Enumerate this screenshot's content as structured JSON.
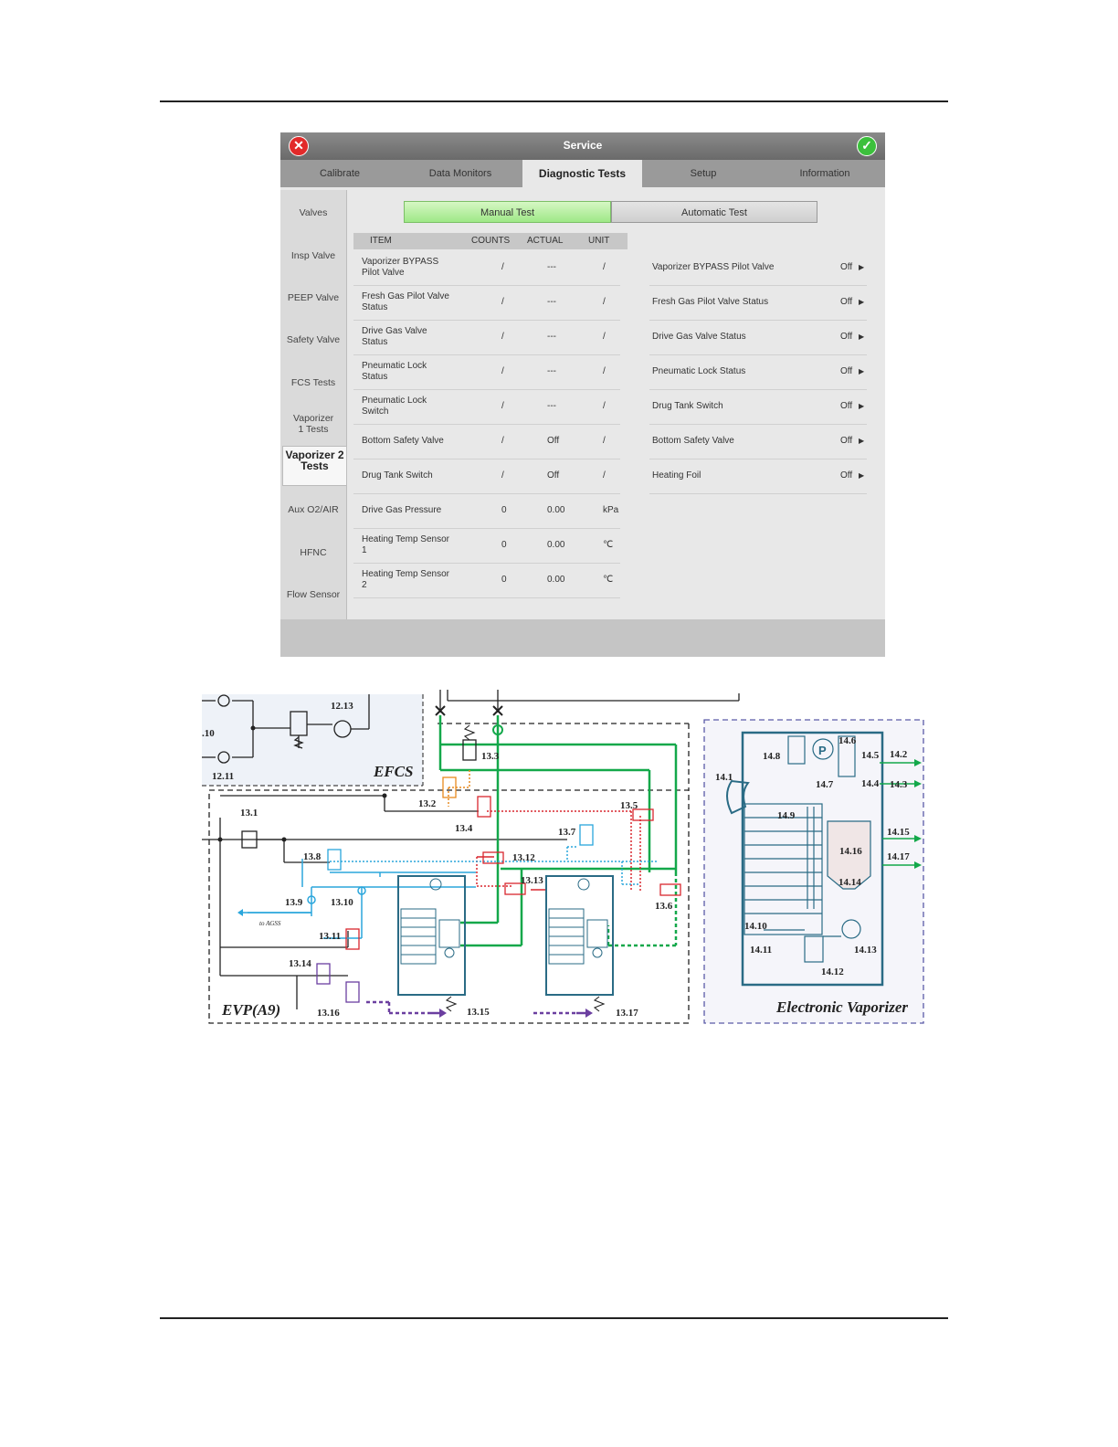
{
  "window": {
    "title": "Service"
  },
  "tabs": [
    "Calibrate",
    "Data Monitors",
    "Diagnostic Tests",
    "Setup",
    "Information"
  ],
  "sidebar": [
    "Valves",
    "Insp Valve",
    "PEEP Valve",
    "Safety Valve",
    "FCS Tests",
    "Vaporizer 1 Tests",
    "Vaporizer 2 Tests",
    "Aux O2/AIR",
    "HFNC",
    "Flow Sensor"
  ],
  "mode": {
    "manual": "Manual Test",
    "automatic": "Automatic Test"
  },
  "table": {
    "headers": {
      "item": "ITEM",
      "counts": "COUNTS",
      "actual": "ACTUAL",
      "unit": "UNIT"
    },
    "rows": [
      {
        "item": "Vaporizer BYPASS Pilot Valve",
        "counts": "/",
        "actual": "---",
        "unit": "/"
      },
      {
        "item": "Fresh Gas Pilot Valve Status",
        "counts": "/",
        "actual": "---",
        "unit": "/"
      },
      {
        "item": "Drive Gas Valve Status",
        "counts": "/",
        "actual": "---",
        "unit": "/"
      },
      {
        "item": "Pneumatic Lock Status",
        "counts": "/",
        "actual": "---",
        "unit": "/"
      },
      {
        "item": "Pneumatic Lock Switch",
        "counts": "/",
        "actual": "---",
        "unit": "/"
      },
      {
        "item": "Bottom Safety Valve",
        "counts": "/",
        "actual": "Off",
        "unit": "/"
      },
      {
        "item": "Drug Tank Switch",
        "counts": "/",
        "actual": "Off",
        "unit": "/"
      },
      {
        "item": "Drive Gas Pressure",
        "counts": "0",
        "actual": "0.00",
        "unit": "kPa"
      },
      {
        "item": "Heating Temp Sensor 1",
        "counts": "0",
        "actual": "0.00",
        "unit": "℃"
      },
      {
        "item": "Heating Temp Sensor 2",
        "counts": "0",
        "actual": "0.00",
        "unit": "℃"
      }
    ]
  },
  "controls": [
    {
      "label": "Vaporizer BYPASS Pilot Valve",
      "value": "Off"
    },
    {
      "label": "Fresh Gas Pilot Valve Status",
      "value": "Off"
    },
    {
      "label": "Drive Gas Valve Status",
      "value": "Off"
    },
    {
      "label": "Pneumatic Lock Status",
      "value": "Off"
    },
    {
      "label": "Drug Tank Switch",
      "value": "Off"
    },
    {
      "label": "Bottom Safety Valve",
      "value": "Off"
    },
    {
      "label": "Heating Foil",
      "value": "Off"
    }
  ],
  "schematic": {
    "sections": {
      "efcs": "EFCS",
      "evp": "EVP(A9)",
      "vaporizer": "Electronic Vaporizer"
    },
    "small_text": "to AGSS",
    "labels": {
      "l1213": "12.13",
      "l10": ".10",
      "l1211": "12.11",
      "l133": "13.3",
      "l132": "13.2",
      "l134": "13.4",
      "l131": "13.1",
      "l135": "13.5",
      "l137": "13.7",
      "l138": "13.8",
      "l1312": "13.12",
      "l1313": "13.13",
      "l139": "13.9",
      "l1310": "13.10",
      "l1311": "13.11",
      "l1314": "13.14",
      "l1316": "13.16",
      "l1315": "13.15",
      "l1317": "13.17",
      "l136": "13.6",
      "l141": "14.1",
      "l148": "14.8",
      "l146": "14.6",
      "l145": "14.5",
      "l142": "14.2",
      "l147": "14.7",
      "l144": "14.4",
      "l143": "14.3",
      "l149": "14.9",
      "l1415": "14.15",
      "l1416": "14.16",
      "l1417": "14.17",
      "l1414": "14.14",
      "l1410": "14.10",
      "l1411": "14.11",
      "l1413": "14.13",
      "l1412": "14.12"
    },
    "colors": {
      "green": "#13a84a",
      "red": "#d9272e",
      "blue": "#2aa6dc",
      "orange": "#e78a1e",
      "purple": "#6b3fa0",
      "teal": "#2a6b85"
    }
  }
}
